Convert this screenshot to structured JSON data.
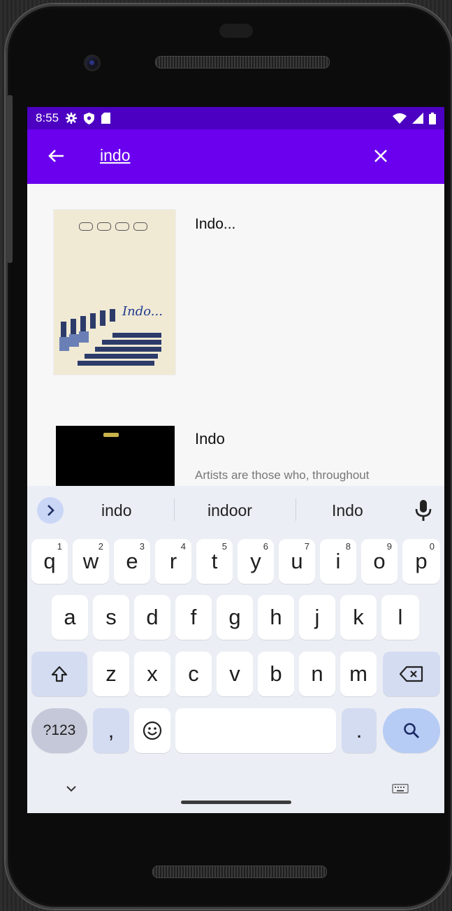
{
  "status_bar": {
    "time": "8:55"
  },
  "search": {
    "query": "indo"
  },
  "results": [
    {
      "title": "Indo..."
    },
    {
      "title": "Indo",
      "description": "Artists are those who, throughout"
    }
  ],
  "poster": {
    "title": "Indo..."
  },
  "keyboard": {
    "suggestions": [
      "indo",
      "indoor",
      "Indo"
    ],
    "row1": [
      "q",
      "w",
      "e",
      "r",
      "t",
      "y",
      "u",
      "i",
      "o",
      "p"
    ],
    "row1_hints": [
      "1",
      "2",
      "3",
      "4",
      "5",
      "6",
      "7",
      "8",
      "9",
      "0"
    ],
    "row2": [
      "a",
      "s",
      "d",
      "f",
      "g",
      "h",
      "j",
      "k",
      "l"
    ],
    "row3": [
      "z",
      "x",
      "c",
      "v",
      "b",
      "n",
      "m"
    ],
    "symbols_label": "?123",
    "comma": ",",
    "period": "."
  },
  "colors": {
    "status_bar": "#4c00c2",
    "app_bar": "#6a00ee",
    "keyboard_bg": "#eceef5"
  }
}
